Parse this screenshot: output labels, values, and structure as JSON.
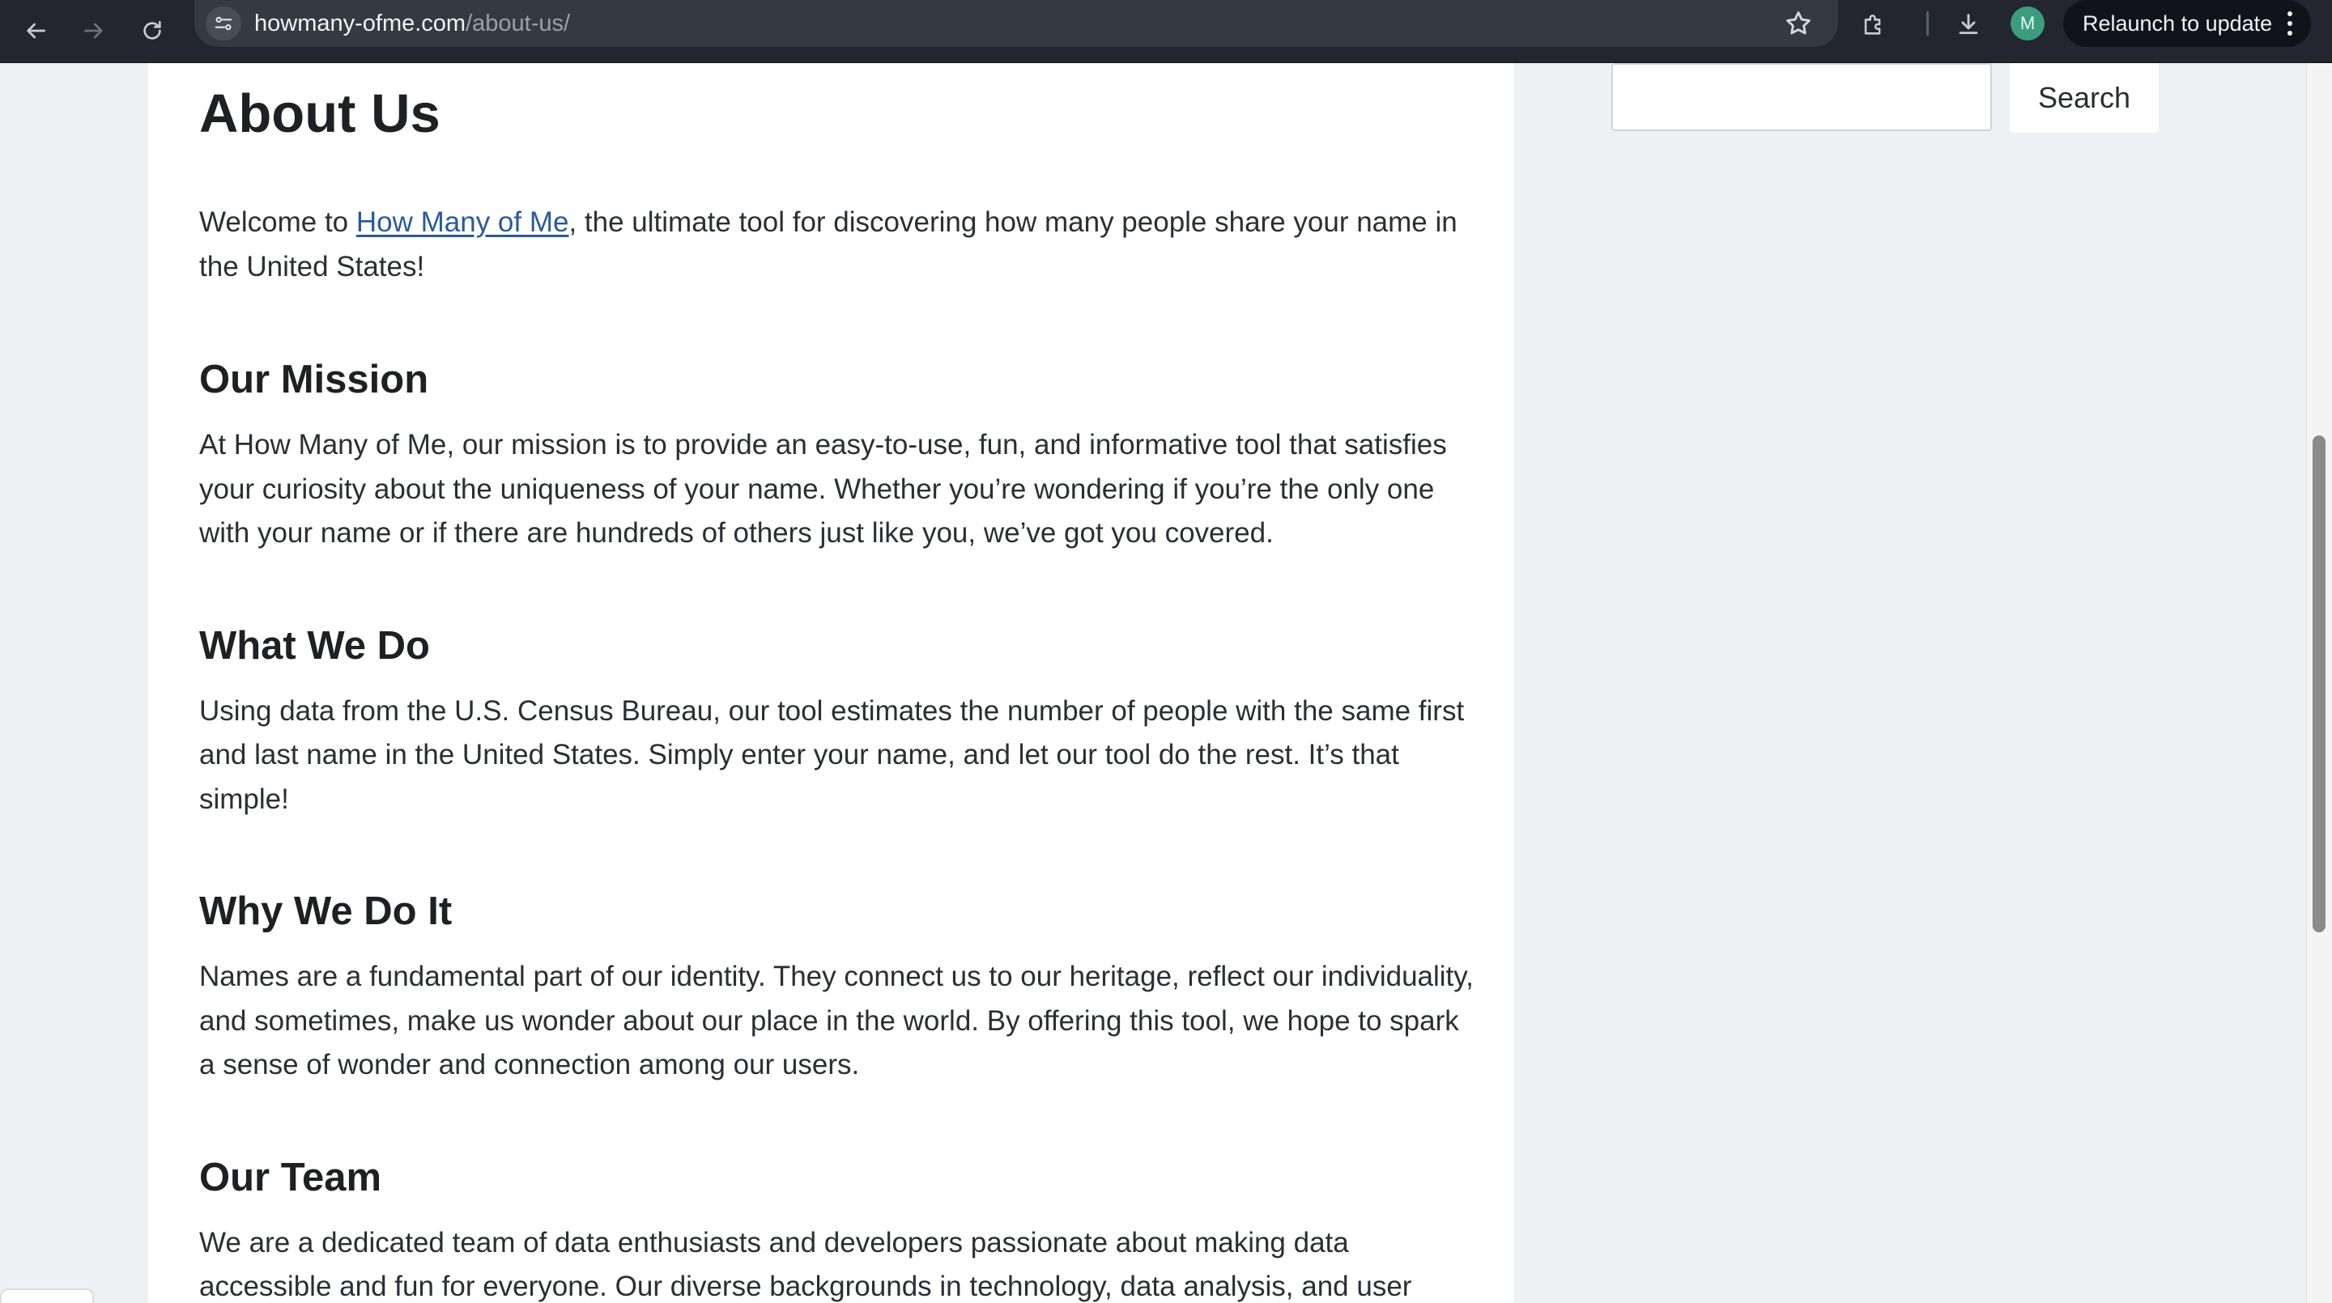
{
  "browser": {
    "url_host": "howmany-ofme.com",
    "url_path": "/about-us/",
    "profile_initial": "M",
    "relaunch_label": "Relaunch to update",
    "icons": [
      "back-arrow-icon",
      "forward-arrow-icon",
      "reload-icon",
      "site-info-icon",
      "star-icon",
      "extensions-icon",
      "download-icon",
      "more-menu-icon"
    ]
  },
  "page": {
    "title": "About Us",
    "intro": {
      "before": "Welcome to ",
      "link_text": "How Many of Me",
      "after": ", the ultimate tool for discovering how many people share your name in the United States!"
    },
    "sections": [
      {
        "heading": "Our Mission",
        "body": "At How Many of Me, our mission is to provide an easy-to-use, fun, and informative tool that satisfies your curiosity about the uniqueness of your name. Whether you’re wondering if you’re the only one with your name or if there are hundreds of others just like you, we’ve got you covered."
      },
      {
        "heading": "What We Do",
        "body": "Using data from the U.S. Census Bureau, our tool estimates the number of people with the same first and last name in the United States. Simply enter your name, and let our tool do the rest. It’s that simple!"
      },
      {
        "heading": "Why We Do It",
        "body": "Names are a fundamental part of our identity. They connect us to our heritage, reflect our individuality, and sometimes, make us wonder about our place in the world. By offering this tool, we hope to spark a sense of wonder and connection among our users."
      },
      {
        "heading": "Our Team",
        "body": "We are a dedicated team of data enthusiasts and developers passionate about making data accessible and fun for everyone. Our diverse backgrounds in technology, data analysis, and user experience"
      }
    ]
  },
  "sidebar": {
    "search_value": "",
    "search_button": "Search"
  },
  "colors": {
    "chrome_bg": "#23262e",
    "link": "#2a5a99",
    "page_bg": "#eef0f3",
    "avatar": "#3a9d7d"
  }
}
